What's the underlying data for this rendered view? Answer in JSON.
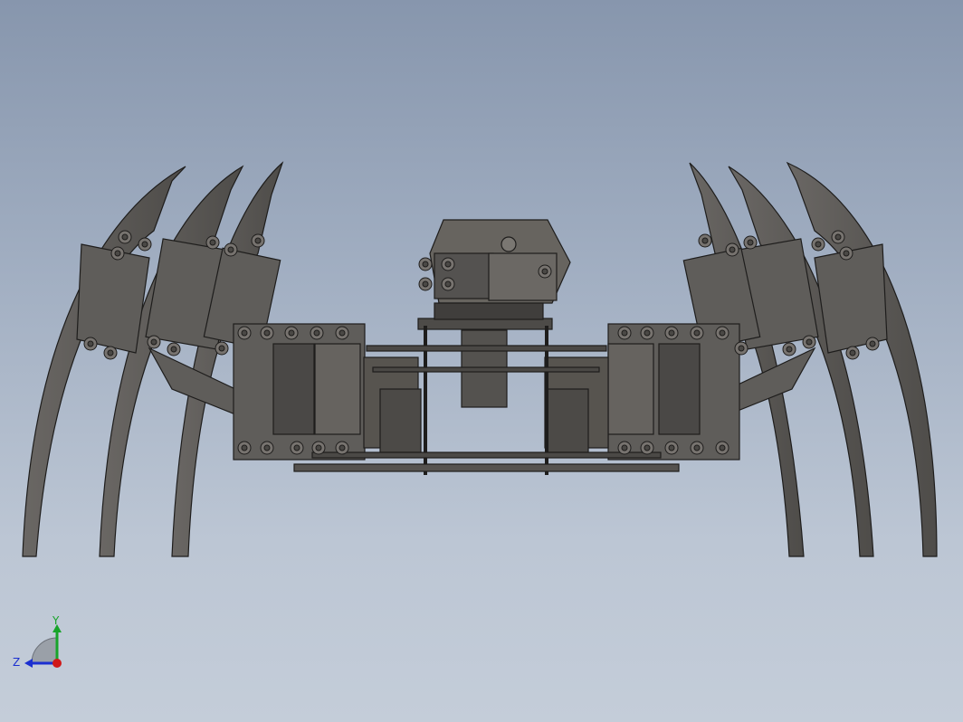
{
  "viewport": {
    "background_top": "#8796ad",
    "background_bottom": "#c4cdd9",
    "model_color": "#5f5d5a",
    "model_dark": "#3d3b39",
    "edge_color": "#1e1d1c"
  },
  "triad": {
    "y_label": "Y",
    "z_label": "Z",
    "y_color": "#18a42a",
    "z_color": "#1b2fd0",
    "x_color": "#d01818"
  }
}
